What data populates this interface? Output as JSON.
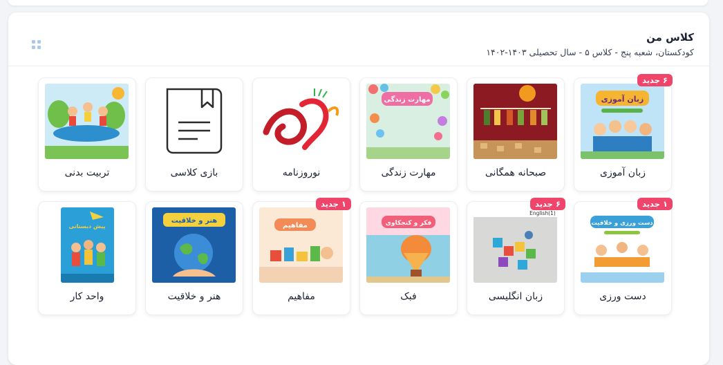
{
  "header": {
    "title": "کلاس من",
    "subtitle": "کودکستان، شعبه پنج - کلاس ۵ - سال تحصیلی ۱۴۰۳-۱۴۰۲"
  },
  "courses": [
    {
      "label": "زبان آموزی",
      "badge": "۶ جدید",
      "cover_title": "زبان آموزی",
      "icon": "language-book-cover"
    },
    {
      "label": "صبحانه همگانی",
      "badge": "",
      "icon": "breakfast-cover"
    },
    {
      "label": "مهارت زندگی",
      "badge": "",
      "cover_title": "مهارت زندگی",
      "icon": "life-skills-cover"
    },
    {
      "label": "نوروزنامه",
      "badge": "",
      "icon": "nowruz-logo"
    },
    {
      "label": "بازی کلاسی",
      "badge": "",
      "icon": "document-icon"
    },
    {
      "label": "تربیت بدنی",
      "badge": "",
      "icon": "physical-education-cover"
    },
    {
      "label": "دست ورزی",
      "badge": "۱ جدید",
      "cover_title": "دست ورزی و خلاقیت",
      "icon": "handwork-cover"
    },
    {
      "label": "زبان انگلیسی",
      "badge": "۶ جدید",
      "cover_title": "English(1)",
      "icon": "english-cover"
    },
    {
      "label": "فبک",
      "badge": "",
      "cover_title": "فکر و کنجکاوی",
      "icon": "fabak-cover"
    },
    {
      "label": "مفاهیم",
      "badge": "۱ جدید",
      "cover_title": "مفاهیم",
      "icon": "concepts-cover"
    },
    {
      "label": "هنر و خلاقیت",
      "badge": "",
      "cover_title": "هنر و خلاقیت",
      "icon": "art-creativity-cover"
    },
    {
      "label": "واحد کار",
      "badge": "",
      "cover_title": "پیش دبستانی",
      "icon": "work-unit-cover"
    }
  ],
  "colors": {
    "badge": "#f0456b",
    "accent": "#a8c8ef"
  }
}
